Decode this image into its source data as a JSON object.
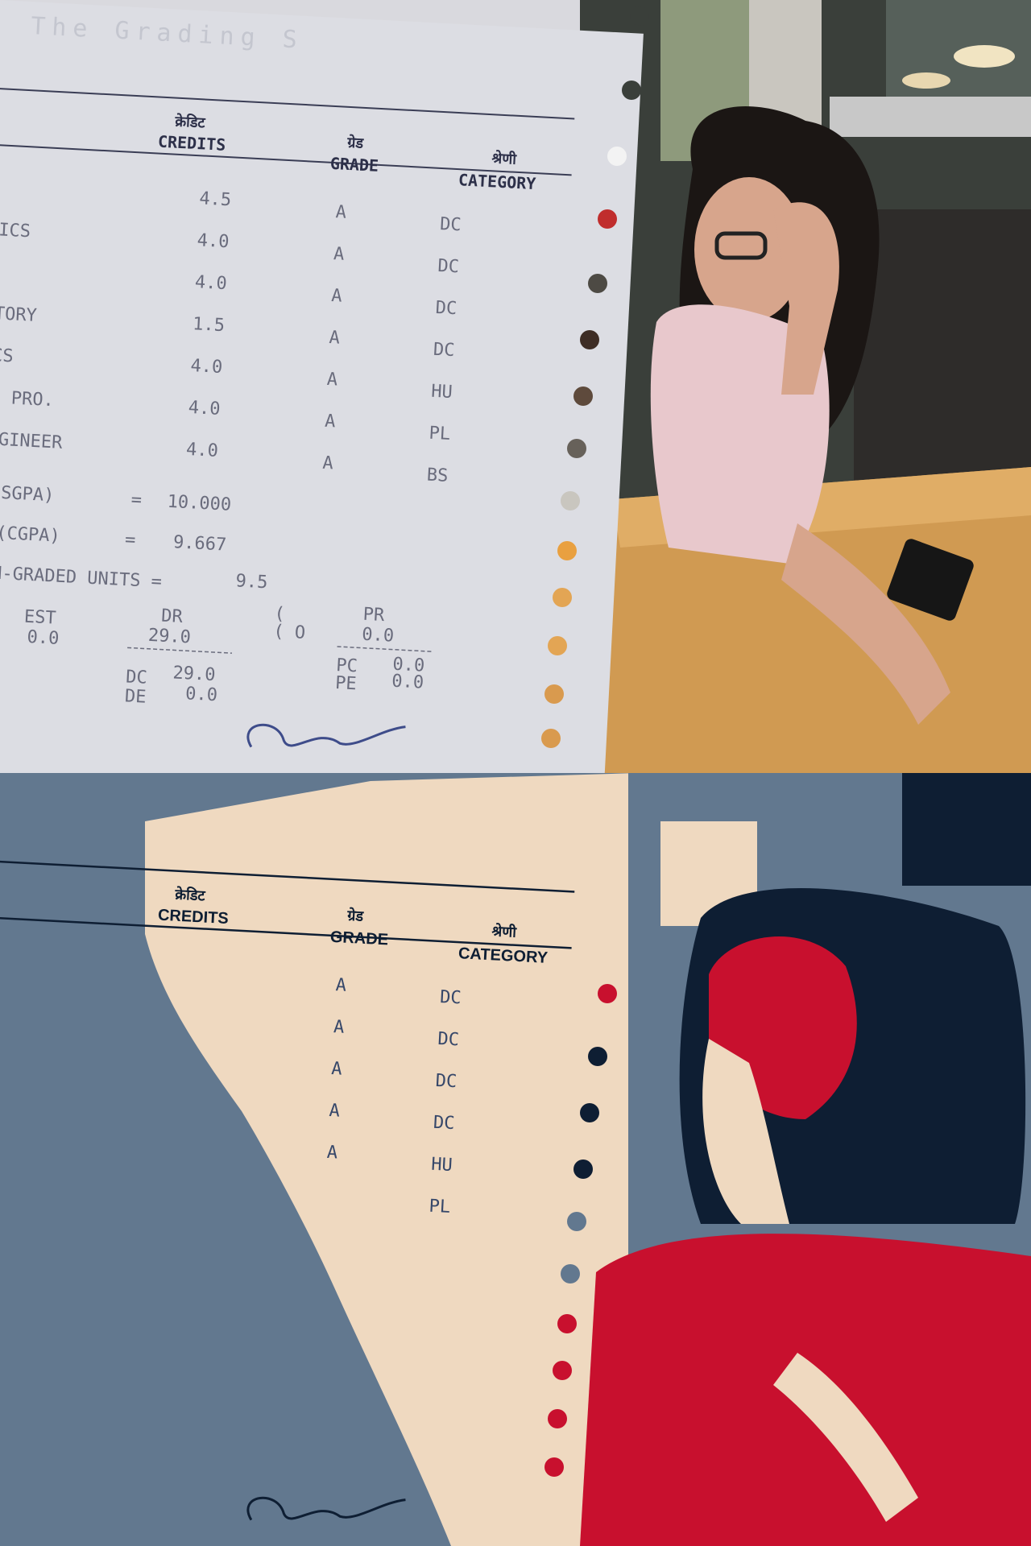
{
  "panels": {
    "top": {
      "style": "photo",
      "bg": "#d9d9de"
    },
    "bottom": {
      "style": "posterized",
      "palette": [
        "#62788f",
        "#efd9c0",
        "#0e1e33",
        "#c8102e"
      ]
    }
  },
  "sheet": {
    "headers": {
      "credits_hi": "क्रेडिट",
      "credits": "CREDITS",
      "grade_hi": "ग्रेड",
      "grade": "GRADE",
      "category_hi": "श्रेणी",
      "category": "CATEGORY"
    },
    "rows": [
      {
        "course": "",
        "credit": "4.5",
        "grade": "A",
        "category": "DC"
      },
      {
        "course": "TICS",
        "credit": "4.0",
        "grade": "A",
        "category": "DC"
      },
      {
        "course": "",
        "credit": "4.0",
        "grade": "A",
        "category": "DC"
      },
      {
        "course": "ATORY",
        "credit": "1.5",
        "grade": "A",
        "category": "DC"
      },
      {
        "course": "ICS",
        "credit": "4.0",
        "grade": "A",
        "category": "HU"
      },
      {
        "course": "IC PRO.",
        "credit": "4.0",
        "grade": "A",
        "category": "PL"
      },
      {
        "course": "ENGINEER",
        "credit": "4.0",
        "grade": "A",
        "category": "BS"
      }
    ],
    "sgpa": {
      "label": "(SGPA)",
      "eq": "=",
      "value": "10.000"
    },
    "cgpa": {
      "label": "(CGPA)",
      "eq": "=",
      "value": "9.667"
    },
    "non_graded": {
      "label": "NON-GRADED UNITS =",
      "value": "9.5"
    },
    "summary": {
      "est": "EST",
      "est_val": "0.0",
      "dr": "DR",
      "dr_val": "29.0",
      "paren": "(",
      "paren_o": "( O",
      "pr": "PR",
      "pr_val": "0.0",
      "dc": "DC",
      "dc_val": "29.0",
      "de": "DE",
      "de_val": "0.0",
      "pc": "PC",
      "pc_val": "0.0",
      "pe": "PE",
      "pe_val": "0.0"
    },
    "faded_title": "The Grading S"
  },
  "bottom_sheet": {
    "categories": [
      "DC",
      "DC",
      "DC",
      "DC",
      "HU",
      "PL"
    ],
    "grades": [
      "A",
      "A",
      "A",
      "A",
      "A"
    ]
  }
}
